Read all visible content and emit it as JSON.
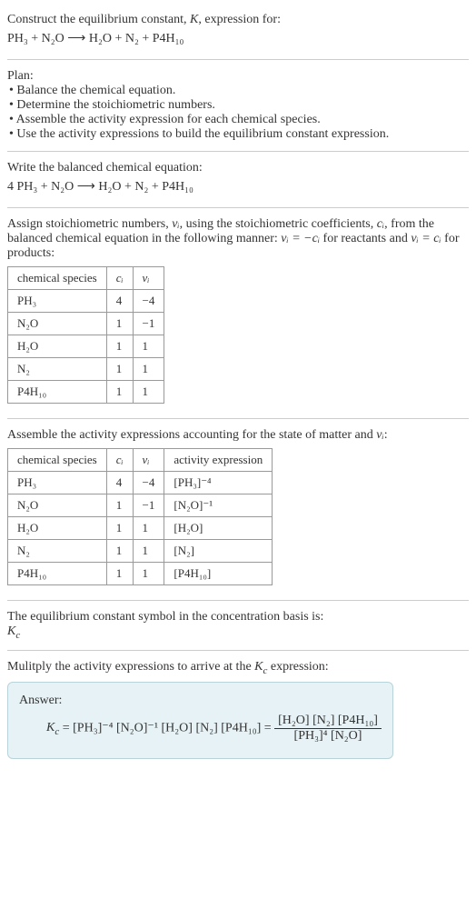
{
  "intro": {
    "line1": "Construct the equilibrium constant, ",
    "k": "K",
    "line1b": ", expression for:"
  },
  "eq1": "PH₃ + N₂O ⟶ H₂O + N₂ + P4H₁₀",
  "plan": {
    "heading": "Plan:",
    "item1": "• Balance the chemical equation.",
    "item2": "• Determine the stoichiometric numbers.",
    "item3": "• Assemble the activity expression for each chemical species.",
    "item4": "• Use the activity expressions to build the equilibrium constant expression."
  },
  "balanced": {
    "heading": "Write the balanced chemical equation:",
    "eq": "4 PH₃ + N₂O ⟶ H₂O + N₂ + P4H₁₀"
  },
  "stoich": {
    "text1": "Assign stoichiometric numbers, ",
    "nu": "νᵢ",
    "text2": ", using the stoichiometric coefficients, ",
    "ci": "cᵢ",
    "text3": ", from the balanced chemical equation in the following manner: ",
    "rel1": "νᵢ = −cᵢ",
    "text4": " for reactants and ",
    "rel2": "νᵢ = cᵢ",
    "text5": " for products:"
  },
  "table1": {
    "h1": "chemical species",
    "h2": "cᵢ",
    "h3": "νᵢ",
    "rows": [
      {
        "sp": "PH₃",
        "c": "4",
        "nu": "−4"
      },
      {
        "sp": "N₂O",
        "c": "1",
        "nu": "−1"
      },
      {
        "sp": "H₂O",
        "c": "1",
        "nu": "1"
      },
      {
        "sp": "N₂",
        "c": "1",
        "nu": "1"
      },
      {
        "sp": "P4H₁₀",
        "c": "1",
        "nu": "1"
      }
    ]
  },
  "activity": {
    "text1": "Assemble the activity expressions accounting for the state of matter and ",
    "nu": "νᵢ",
    "text2": ":"
  },
  "table2": {
    "h1": "chemical species",
    "h2": "cᵢ",
    "h3": "νᵢ",
    "h4": "activity expression",
    "rows": [
      {
        "sp": "PH₃",
        "c": "4",
        "nu": "−4",
        "act": "[PH₃]⁻⁴"
      },
      {
        "sp": "N₂O",
        "c": "1",
        "nu": "−1",
        "act": "[N₂O]⁻¹"
      },
      {
        "sp": "H₂O",
        "c": "1",
        "nu": "1",
        "act": "[H₂O]"
      },
      {
        "sp": "N₂",
        "c": "1",
        "nu": "1",
        "act": "[N₂]"
      },
      {
        "sp": "P4H₁₀",
        "c": "1",
        "nu": "1",
        "act": "[P4H₁₀]"
      }
    ]
  },
  "kc_symbol": {
    "text": "The equilibrium constant symbol in the concentration basis is:",
    "kc": "K_c"
  },
  "multiply": {
    "text1": "Mulitply the activity expressions to arrive at the ",
    "kc": "K_c",
    "text2": " expression:"
  },
  "answer": {
    "label": "Answer:",
    "kc": "K_c",
    "eq_left": " = [PH₃]⁻⁴ [N₂O]⁻¹ [H₂O] [N₂] [P4H₁₀] = ",
    "num": "[H₂O] [N₂] [P4H₁₀]",
    "den": "[PH₃]⁴ [N₂O]"
  }
}
